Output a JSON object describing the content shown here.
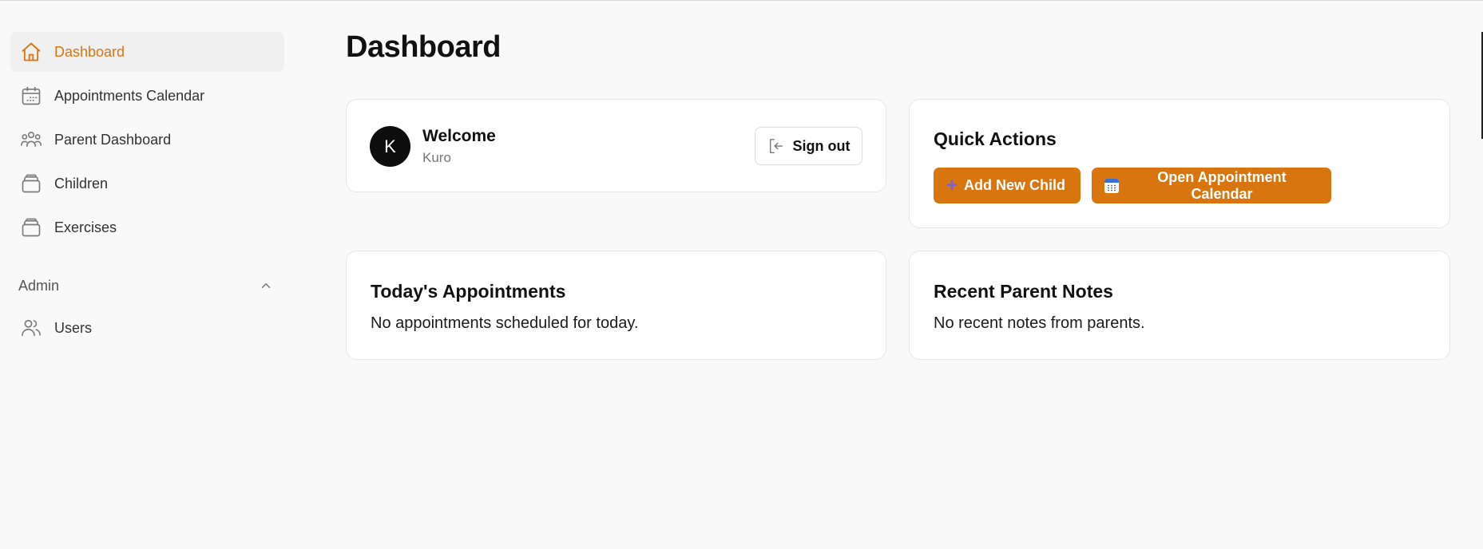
{
  "sidebar": {
    "items": [
      {
        "label": "Dashboard",
        "icon": "home-icon",
        "active": true
      },
      {
        "label": "Appointments Calendar",
        "icon": "calendar-icon",
        "active": false
      },
      {
        "label": "Parent Dashboard",
        "icon": "users-group-icon",
        "active": false
      },
      {
        "label": "Children",
        "icon": "box-stack-icon",
        "active": false
      },
      {
        "label": "Exercises",
        "icon": "box-stack-icon",
        "active": false
      }
    ],
    "admin_section": {
      "label": "Admin",
      "expanded": true,
      "items": [
        {
          "label": "Users",
          "icon": "users-icon"
        }
      ]
    }
  },
  "page": {
    "title": "Dashboard"
  },
  "welcome_card": {
    "title": "Welcome",
    "username": "Kuro",
    "avatar_initial": "K",
    "signout_label": "Sign out"
  },
  "quick_actions": {
    "title": "Quick Actions",
    "add_child_label": "Add New Child",
    "open_calendar_label": "Open Appointment Calendar"
  },
  "todays_appointments": {
    "title": "Today's Appointments",
    "empty_text": "No appointments scheduled for today."
  },
  "recent_notes": {
    "title": "Recent Parent Notes",
    "empty_text": "No recent notes from parents."
  },
  "colors": {
    "accent": "#dc7412",
    "button_bg": "#d8750f",
    "background": "#f9f9f9"
  }
}
